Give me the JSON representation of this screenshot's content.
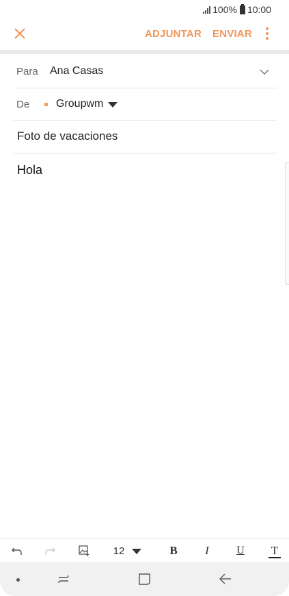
{
  "status_bar": {
    "battery_level": "100%",
    "time": "10:00"
  },
  "action_bar": {
    "close_icon": "close-icon",
    "attach_label": "ADJUNTAR",
    "send_label": "ENVIAR",
    "more_icon": "more-vert-icon",
    "accent_color": "#f0955a"
  },
  "compose": {
    "to_label": "Para",
    "to_value": "Ana Casas",
    "from_label": "De",
    "from_value": "Groupwm",
    "subject": "Foto de vacaciones",
    "body": "Hola"
  },
  "format_toolbar": {
    "undo_icon": "undo-icon",
    "redo_icon": "redo-icon",
    "insert_image_icon": "insert-image-icon",
    "font_size": "12",
    "bold_label": "B",
    "italic_label": "I",
    "underline_label": "U",
    "text_style_label": "T"
  },
  "nav_bar": {
    "recents_icon": "recents-icon",
    "home_icon": "home-icon",
    "back_icon": "back-icon"
  }
}
